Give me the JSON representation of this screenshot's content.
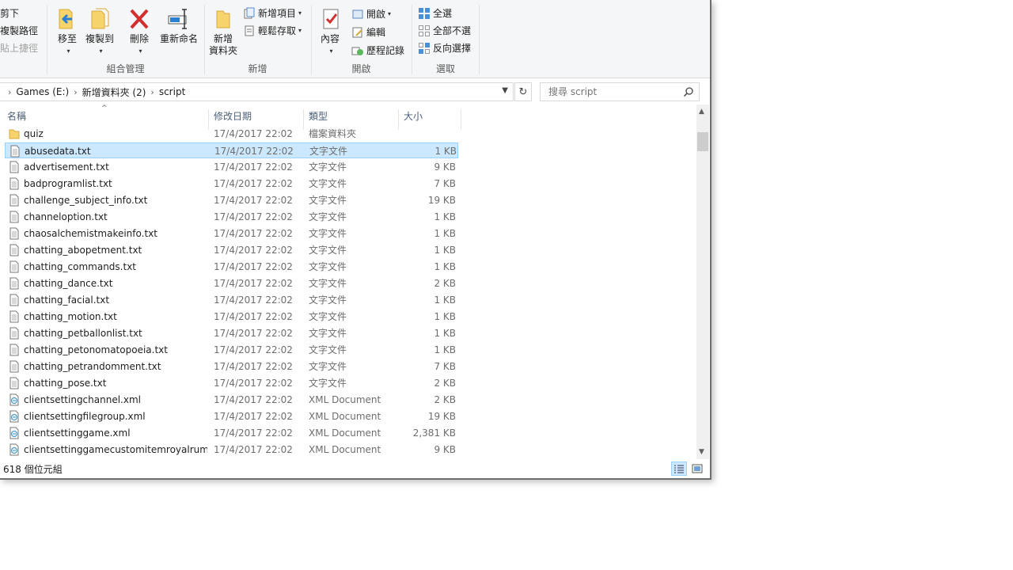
{
  "ribbon": {
    "clipboard": {
      "cut": "剪下",
      "copy_path": "複製路徑",
      "paste_shortcut": "貼上捷徑"
    },
    "organize": {
      "label": "組合管理",
      "move_to": "移至",
      "copy_to": "複製到",
      "delete": "刪除",
      "rename": "重新命名"
    },
    "new": {
      "label": "新增",
      "new_folder_line1": "新增",
      "new_folder_line2": "資料夾",
      "new_item": "新增項目",
      "easy_access": "輕鬆存取"
    },
    "open": {
      "label": "開啟",
      "properties": "內容",
      "open": "開啟",
      "edit": "編輯",
      "history": "歷程記錄"
    },
    "select": {
      "label": "選取",
      "select_all": "全選",
      "select_none": "全部不選",
      "invert": "反向選擇"
    }
  },
  "address": {
    "crumbs": [
      "Games (E:)",
      "新增資料夾 (2)",
      "script"
    ],
    "search_placeholder": "搜尋 script"
  },
  "columns": {
    "name": "名稱",
    "date": "修改日期",
    "type": "類型",
    "size": "大小"
  },
  "files": [
    {
      "name": "quiz",
      "date": "17/4/2017 22:02",
      "type": "檔案資料夾",
      "size": "",
      "icon": "folder-icon"
    },
    {
      "name": "abusedata.txt",
      "date": "17/4/2017 22:02",
      "type": "文字文件",
      "size": "1 KB",
      "icon": "text-file-icon",
      "selected": true
    },
    {
      "name": "advertisement.txt",
      "date": "17/4/2017 22:02",
      "type": "文字文件",
      "size": "9 KB",
      "icon": "text-file-icon"
    },
    {
      "name": "badprogramlist.txt",
      "date": "17/4/2017 22:02",
      "type": "文字文件",
      "size": "7 KB",
      "icon": "text-file-icon"
    },
    {
      "name": "challenge_subject_info.txt",
      "date": "17/4/2017 22:02",
      "type": "文字文件",
      "size": "19 KB",
      "icon": "text-file-icon"
    },
    {
      "name": "channeloption.txt",
      "date": "17/4/2017 22:02",
      "type": "文字文件",
      "size": "1 KB",
      "icon": "text-file-icon"
    },
    {
      "name": "chaosalchemistmakeinfo.txt",
      "date": "17/4/2017 22:02",
      "type": "文字文件",
      "size": "1 KB",
      "icon": "text-file-icon"
    },
    {
      "name": "chatting_abopetment.txt",
      "date": "17/4/2017 22:02",
      "type": "文字文件",
      "size": "1 KB",
      "icon": "text-file-icon"
    },
    {
      "name": "chatting_commands.txt",
      "date": "17/4/2017 22:02",
      "type": "文字文件",
      "size": "1 KB",
      "icon": "text-file-icon"
    },
    {
      "name": "chatting_dance.txt",
      "date": "17/4/2017 22:02",
      "type": "文字文件",
      "size": "2 KB",
      "icon": "text-file-icon"
    },
    {
      "name": "chatting_facial.txt",
      "date": "17/4/2017 22:02",
      "type": "文字文件",
      "size": "1 KB",
      "icon": "text-file-icon"
    },
    {
      "name": "chatting_motion.txt",
      "date": "17/4/2017 22:02",
      "type": "文字文件",
      "size": "1 KB",
      "icon": "text-file-icon"
    },
    {
      "name": "chatting_petballonlist.txt",
      "date": "17/4/2017 22:02",
      "type": "文字文件",
      "size": "1 KB",
      "icon": "text-file-icon"
    },
    {
      "name": "chatting_petonomatopoeia.txt",
      "date": "17/4/2017 22:02",
      "type": "文字文件",
      "size": "1 KB",
      "icon": "text-file-icon"
    },
    {
      "name": "chatting_petrandomment.txt",
      "date": "17/4/2017 22:02",
      "type": "文字文件",
      "size": "7 KB",
      "icon": "text-file-icon"
    },
    {
      "name": "chatting_pose.txt",
      "date": "17/4/2017 22:02",
      "type": "文字文件",
      "size": "2 KB",
      "icon": "text-file-icon"
    },
    {
      "name": "clientsettingchannel.xml",
      "date": "17/4/2017 22:02",
      "type": "XML Document",
      "size": "2 KB",
      "icon": "xml-file-icon"
    },
    {
      "name": "clientsettingfilegroup.xml",
      "date": "17/4/2017 22:02",
      "type": "XML Document",
      "size": "19 KB",
      "icon": "xml-file-icon"
    },
    {
      "name": "clientsettinggame.xml",
      "date": "17/4/2017 22:02",
      "type": "XML Document",
      "size": "2,381 KB",
      "icon": "xml-file-icon"
    },
    {
      "name": "clientsettinggamecustomitemroyalrum...",
      "date": "17/4/2017 22:02",
      "type": "XML Document",
      "size": "9 KB",
      "icon": "xml-file-icon"
    }
  ],
  "status": {
    "item_count": "618 個位元組"
  },
  "colors": {
    "selection_bg": "#cce8ff",
    "selection_border": "#99d1ff",
    "header_text": "#4c607a"
  }
}
